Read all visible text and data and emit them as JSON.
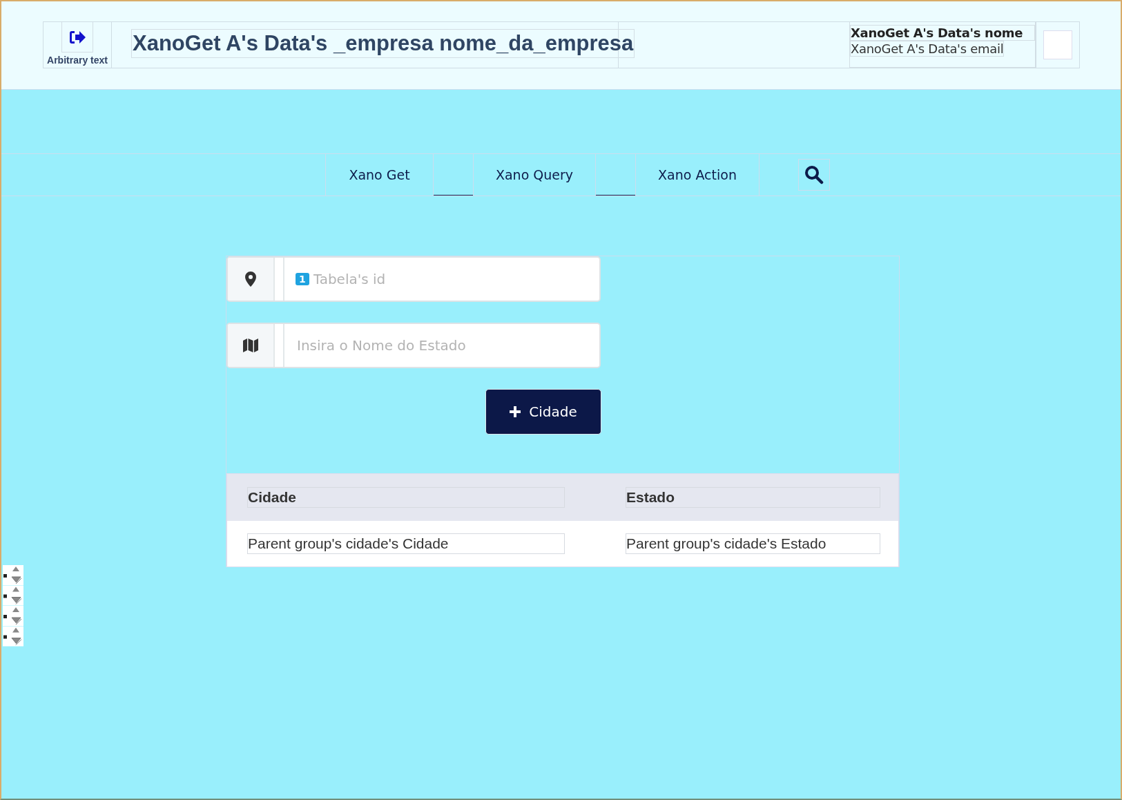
{
  "header": {
    "logout_label": "Arbitrary text",
    "title": "XanoGet A's Data's _empresa nome_da_empresa",
    "user_name": "XanoGet A's Data's nome",
    "user_email": "XanoGet A's Data's email"
  },
  "nav": {
    "items": [
      {
        "label": "Xano Get"
      },
      {
        "label": "Xano Query"
      },
      {
        "label": "Xano Action"
      }
    ]
  },
  "form": {
    "fields": [
      {
        "kind": "number",
        "badge": "1",
        "placeholder": "Tabela's id"
      },
      {
        "kind": "text",
        "placeholder": "Insira o Nome do Estado"
      }
    ],
    "button": {
      "label": "Cidade"
    }
  },
  "table": {
    "columns": [
      "Cidade",
      "Estado"
    ],
    "rows": [
      [
        "Parent group's cidade's Cidade",
        "Parent group's cidade's Estado"
      ]
    ]
  }
}
